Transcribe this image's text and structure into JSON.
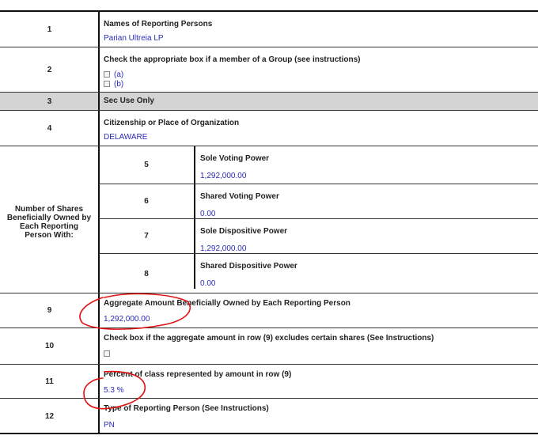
{
  "rows": {
    "r1": {
      "num": "1",
      "label": "Names of Reporting Persons",
      "value": "Parian Ultreia LP"
    },
    "r2": {
      "num": "2",
      "label": "Check the appropriate box if a member of a Group (see instructions)",
      "opt_a": "(a)",
      "opt_b": "(b)"
    },
    "r3": {
      "num": "3",
      "label": "Sec Use Only"
    },
    "r4": {
      "num": "4",
      "label": "Citizenship or Place of Organization",
      "value": "DELAWARE"
    },
    "shares_label": [
      "Number of Shares",
      "Beneficially Owned by",
      "Each Reporting",
      "Person With:"
    ],
    "r5": {
      "num": "5",
      "label": "Sole Voting Power",
      "value": "1,292,000.00"
    },
    "r6": {
      "num": "6",
      "label": "Shared Voting Power",
      "value": "0.00"
    },
    "r7": {
      "num": "7",
      "label": "Sole Dispositive Power",
      "value": "1,292,000.00"
    },
    "r8": {
      "num": "8",
      "label": "Shared Dispositive Power",
      "value": "0.00"
    },
    "r9": {
      "num": "9",
      "label": "Aggregate Amount Beneficially Owned by Each Reporting Person",
      "value": "1,292,000.00"
    },
    "r10": {
      "num": "10",
      "label": "Check box if the aggregate amount in row (9) excludes certain shares (See Instructions)"
    },
    "r11": {
      "num": "11",
      "label": "Percent of class represented by amount in row (9)",
      "value": "5.3 %"
    },
    "r12": {
      "num": "12",
      "label": "Type of Reporting Person (See Instructions)",
      "value": "PN"
    }
  },
  "annotation_color": "#e01010"
}
